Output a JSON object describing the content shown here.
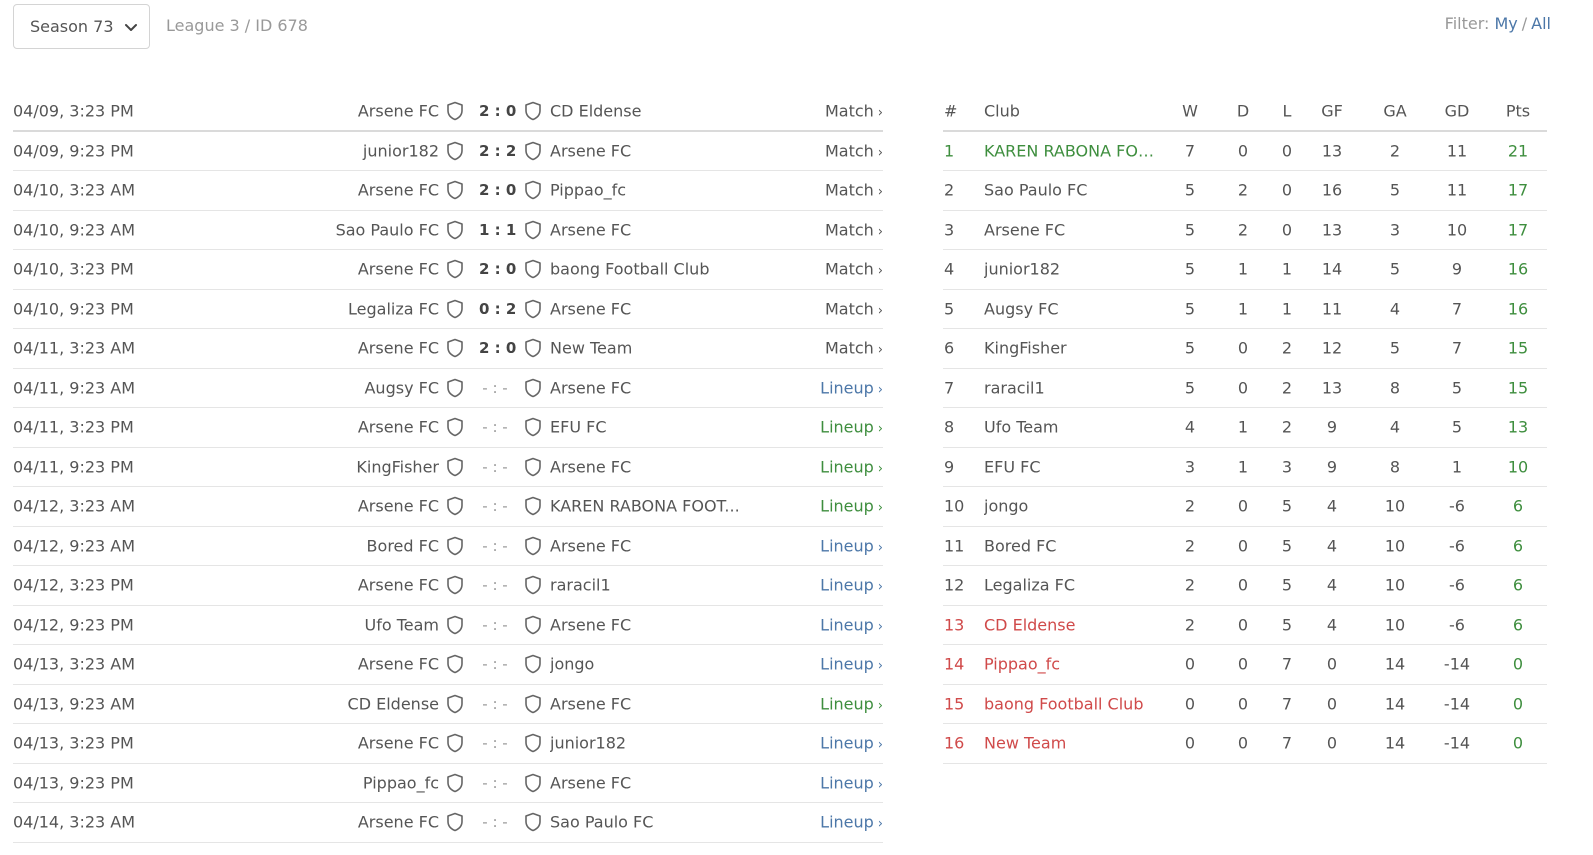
{
  "header": {
    "season_select": "Season 73",
    "league_id": "League 3 / ID 678",
    "filter_label": "Filter:",
    "filter_my": "My",
    "filter_sep": "/",
    "filter_all": "All"
  },
  "matches": [
    {
      "date": "04/09, 3:23 PM",
      "home": "Arsene FC",
      "score": "2 : 0",
      "away": "CD Eldense",
      "action": "Match",
      "kind": "match"
    },
    {
      "date": "04/09, 9:23 PM",
      "home": "junior182",
      "score": "2 : 2",
      "away": "Arsene FC",
      "action": "Match",
      "kind": "match"
    },
    {
      "date": "04/10, 3:23 AM",
      "home": "Arsene FC",
      "score": "2 : 0",
      "away": "Pippao_fc",
      "action": "Match",
      "kind": "match"
    },
    {
      "date": "04/10, 9:23 AM",
      "home": "Sao Paulo FC",
      "score": "1 : 1",
      "away": "Arsene FC",
      "action": "Match",
      "kind": "match"
    },
    {
      "date": "04/10, 3:23 PM",
      "home": "Arsene FC",
      "score": "2 : 0",
      "away": "baong Football Club",
      "action": "Match",
      "kind": "match"
    },
    {
      "date": "04/10, 9:23 PM",
      "home": "Legaliza FC",
      "score": "0 : 2",
      "away": "Arsene FC",
      "action": "Match",
      "kind": "match"
    },
    {
      "date": "04/11, 3:23 AM",
      "home": "Arsene FC",
      "score": "2 : 0",
      "away": "New Team",
      "action": "Match",
      "kind": "match"
    },
    {
      "date": "04/11, 9:23 AM",
      "home": "Augsy FC",
      "score": "- : -",
      "away": "Arsene FC",
      "action": "Lineup",
      "kind": "lineup-blue"
    },
    {
      "date": "04/11, 3:23 PM",
      "home": "Arsene FC",
      "score": "- : -",
      "away": "EFU FC",
      "action": "Lineup",
      "kind": "lineup-green"
    },
    {
      "date": "04/11, 9:23 PM",
      "home": "KingFisher",
      "score": "- : -",
      "away": "Arsene FC",
      "action": "Lineup",
      "kind": "lineup-green"
    },
    {
      "date": "04/12, 3:23 AM",
      "home": "Arsene FC",
      "score": "- : -",
      "away": "KAREN RABONA FOOT...",
      "action": "Lineup",
      "kind": "lineup-green"
    },
    {
      "date": "04/12, 9:23 AM",
      "home": "Bored FC",
      "score": "- : -",
      "away": "Arsene FC",
      "action": "Lineup",
      "kind": "lineup-blue"
    },
    {
      "date": "04/12, 3:23 PM",
      "home": "Arsene FC",
      "score": "- : -",
      "away": "raracil1",
      "action": "Lineup",
      "kind": "lineup-blue"
    },
    {
      "date": "04/12, 9:23 PM",
      "home": "Ufo Team",
      "score": "- : -",
      "away": "Arsene FC",
      "action": "Lineup",
      "kind": "lineup-blue"
    },
    {
      "date": "04/13, 3:23 AM",
      "home": "Arsene FC",
      "score": "- : -",
      "away": "jongo",
      "action": "Lineup",
      "kind": "lineup-blue"
    },
    {
      "date": "04/13, 9:23 AM",
      "home": "CD Eldense",
      "score": "- : -",
      "away": "Arsene FC",
      "action": "Lineup",
      "kind": "lineup-green"
    },
    {
      "date": "04/13, 3:23 PM",
      "home": "Arsene FC",
      "score": "- : -",
      "away": "junior182",
      "action": "Lineup",
      "kind": "lineup-blue"
    },
    {
      "date": "04/13, 9:23 PM",
      "home": "Pippao_fc",
      "score": "- : -",
      "away": "Arsene FC",
      "action": "Lineup",
      "kind": "lineup-blue"
    },
    {
      "date": "04/14, 3:23 AM",
      "home": "Arsene FC",
      "score": "- : -",
      "away": "Sao Paulo FC",
      "action": "Lineup",
      "kind": "lineup-blue"
    }
  ],
  "standings": {
    "headers": {
      "pos": "#",
      "club": "Club",
      "w": "W",
      "d": "D",
      "l": "L",
      "gf": "GF",
      "ga": "GA",
      "gd": "GD",
      "pts": "Pts"
    },
    "rows": [
      {
        "pos": "1",
        "club": "KAREN RABONA FOO...",
        "w": "7",
        "d": "0",
        "l": "0",
        "gf": "13",
        "ga": "2",
        "gd": "11",
        "pts": "21",
        "zone": "promo"
      },
      {
        "pos": "2",
        "club": "Sao Paulo FC",
        "w": "5",
        "d": "2",
        "l": "0",
        "gf": "16",
        "ga": "5",
        "gd": "11",
        "pts": "17",
        "zone": ""
      },
      {
        "pos": "3",
        "club": "Arsene FC",
        "w": "5",
        "d": "2",
        "l": "0",
        "gf": "13",
        "ga": "3",
        "gd": "10",
        "pts": "17",
        "zone": ""
      },
      {
        "pos": "4",
        "club": "junior182",
        "w": "5",
        "d": "1",
        "l": "1",
        "gf": "14",
        "ga": "5",
        "gd": "9",
        "pts": "16",
        "zone": ""
      },
      {
        "pos": "5",
        "club": "Augsy FC",
        "w": "5",
        "d": "1",
        "l": "1",
        "gf": "11",
        "ga": "4",
        "gd": "7",
        "pts": "16",
        "zone": ""
      },
      {
        "pos": "6",
        "club": "KingFisher",
        "w": "5",
        "d": "0",
        "l": "2",
        "gf": "12",
        "ga": "5",
        "gd": "7",
        "pts": "15",
        "zone": ""
      },
      {
        "pos": "7",
        "club": "raracil1",
        "w": "5",
        "d": "0",
        "l": "2",
        "gf": "13",
        "ga": "8",
        "gd": "5",
        "pts": "15",
        "zone": ""
      },
      {
        "pos": "8",
        "club": "Ufo Team",
        "w": "4",
        "d": "1",
        "l": "2",
        "gf": "9",
        "ga": "4",
        "gd": "5",
        "pts": "13",
        "zone": ""
      },
      {
        "pos": "9",
        "club": "EFU FC",
        "w": "3",
        "d": "1",
        "l": "3",
        "gf": "9",
        "ga": "8",
        "gd": "1",
        "pts": "10",
        "zone": ""
      },
      {
        "pos": "10",
        "club": "jongo",
        "w": "2",
        "d": "0",
        "l": "5",
        "gf": "4",
        "ga": "10",
        "gd": "-6",
        "pts": "6",
        "zone": ""
      },
      {
        "pos": "11",
        "club": "Bored FC",
        "w": "2",
        "d": "0",
        "l": "5",
        "gf": "4",
        "ga": "10",
        "gd": "-6",
        "pts": "6",
        "zone": ""
      },
      {
        "pos": "12",
        "club": "Legaliza FC",
        "w": "2",
        "d": "0",
        "l": "5",
        "gf": "4",
        "ga": "10",
        "gd": "-6",
        "pts": "6",
        "zone": ""
      },
      {
        "pos": "13",
        "club": "CD Eldense",
        "w": "2",
        "d": "0",
        "l": "5",
        "gf": "4",
        "ga": "10",
        "gd": "-6",
        "pts": "6",
        "zone": "releg"
      },
      {
        "pos": "14",
        "club": "Pippao_fc",
        "w": "0",
        "d": "0",
        "l": "7",
        "gf": "0",
        "ga": "14",
        "gd": "-14",
        "pts": "0",
        "zone": "releg"
      },
      {
        "pos": "15",
        "club": "baong Football Club",
        "w": "0",
        "d": "0",
        "l": "7",
        "gf": "0",
        "ga": "14",
        "gd": "-14",
        "pts": "0",
        "zone": "releg"
      },
      {
        "pos": "16",
        "club": "New Team",
        "w": "0",
        "d": "0",
        "l": "7",
        "gf": "0",
        "ga": "14",
        "gd": "-14",
        "pts": "0",
        "zone": "releg"
      }
    ]
  },
  "icons": {
    "shield": "shield-icon",
    "chevron": "chevron-down-icon",
    "arrow": "chevron-right-icon"
  },
  "colors": {
    "link_blue": "#4c77a8",
    "green": "#3e8e3e",
    "red": "#d04a4a"
  }
}
